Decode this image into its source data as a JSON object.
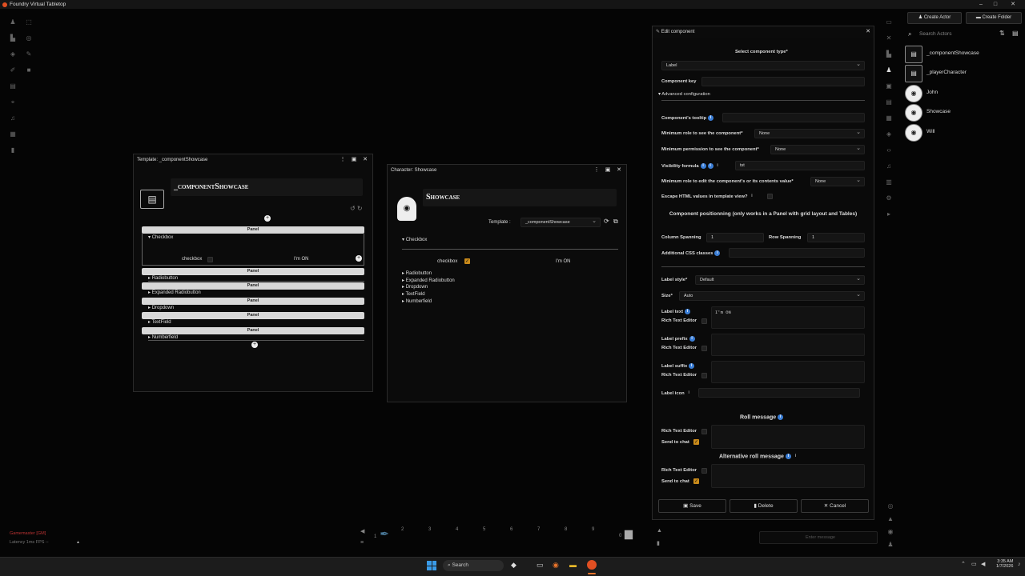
{
  "app": {
    "title": "Foundry Virtual Tabletop"
  },
  "left_tools": [
    "token-icon",
    "measure-icon",
    "tiles-icon",
    "draw-icon",
    "walls-icon",
    "lighting-icon",
    "sounds-icon",
    "regions-icon",
    "notes-icon",
    "select-icon",
    "target-icon",
    "ruler-icon"
  ],
  "right_sidebar": {
    "create_actor": "Create Actor",
    "create_folder": "Create Folder",
    "search_placeholder": "Search Actors",
    "actors": [
      {
        "name": "_componentShowcase",
        "icon": "sheet-icon"
      },
      {
        "name": "_playerCharacter",
        "icon": "sheet-icon"
      },
      {
        "name": "John",
        "icon": "hood-icon"
      },
      {
        "name": "Showcase",
        "icon": "hood-icon"
      },
      {
        "name": "Will",
        "icon": "hood-icon"
      }
    ]
  },
  "template_window": {
    "title": "Template: _componentShowcase",
    "name": "_componentShowcase",
    "panel_label": "Panel",
    "checkbox_section": "Checkbox",
    "checkbox_label": "checkbox",
    "im_on": "I'm ON",
    "sections": [
      "Radiobutton",
      "Expanded Radiobutton",
      "Dropdown",
      "TextField",
      "Numberfield"
    ]
  },
  "character_window": {
    "title": "Character: Showcase",
    "name": "Showcase",
    "template_label": "Template :",
    "template_value": "_componentShowcase",
    "checkbox_section": "Checkbox",
    "checkbox_label": "checkbox",
    "im_on": "I'm ON",
    "sections": [
      "Radiobutton",
      "Expanded Radiobutton",
      "Dropdown",
      "TextField",
      "Numberfield"
    ]
  },
  "edit_component": {
    "title": "Edit component",
    "select_type_label": "Select component type*",
    "type_value": "Label",
    "component_key_label": "Component key",
    "component_key_value": "",
    "advanced_config": "Advanced configuration",
    "tooltip_label": "Component's tooltip",
    "min_role_see_label": "Minimum role to see the component*",
    "min_role_see_value": "None",
    "min_perm_see_label": "Minimum permission to see the component*",
    "min_perm_see_value": "None",
    "visibility_label": "Visibility formula",
    "visibility_value": "tst",
    "min_role_edit_label": "Minimum role to edit the component's or its contents value*",
    "min_role_edit_value": "None",
    "escape_html_label": "Escape HTML values in template view?",
    "positioning_title": "Component positionning (only works in a Panel with grid layout and Tables)",
    "col_span_label": "Column Spanning",
    "col_span_value": "1",
    "row_span_label": "Row Spanning",
    "row_span_value": "1",
    "css_label": "Additional CSS classes",
    "label_style_label": "Label style*",
    "label_style_value": "Default",
    "size_label": "Size*",
    "size_value": "Auto",
    "label_text_label": "Label text",
    "label_text_value": "I'm ON",
    "rich_text_editor": "Rich Text Editor",
    "label_prefix_label": "Label prefix",
    "label_suffix_label": "Label suffix",
    "label_icon_label": "Label icon",
    "roll_message_title": "Roll message",
    "send_to_chat": "Send to chat",
    "alt_roll_message_title": "Alternative roll message",
    "save": "Save",
    "delete": "Delete",
    "cancel": "Cancel"
  },
  "players": {
    "gm": "Gamemaster [GM]",
    "latency": "Latency  1ms  FPS  --"
  },
  "hotbar": {
    "slots": [
      "1",
      "2",
      "3",
      "4",
      "5",
      "6",
      "7",
      "8",
      "9",
      "0"
    ]
  },
  "chat": {
    "placeholder": "Enter message"
  },
  "taskbar": {
    "search": "Search",
    "time": "3:35 AM",
    "date": "1/7/2026"
  }
}
